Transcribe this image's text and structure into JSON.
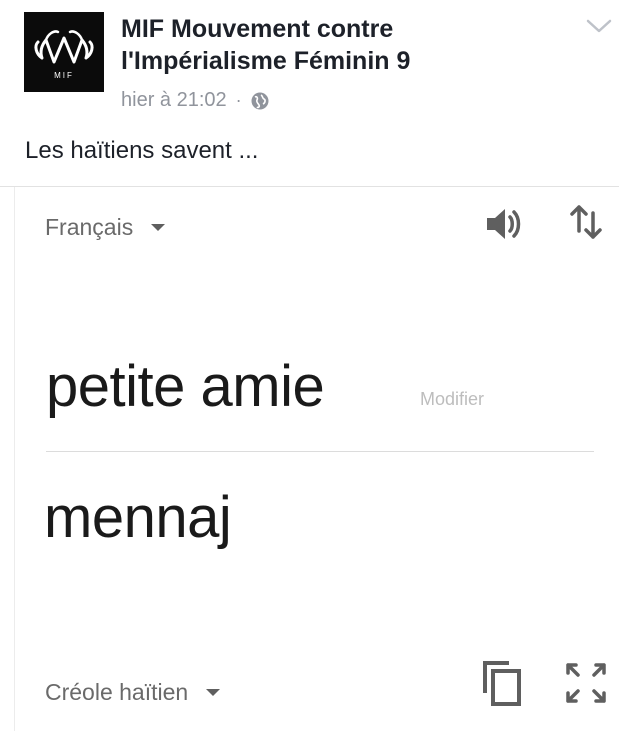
{
  "post": {
    "page_name": "MIF Mouvement contre l'Impérialisme Féminin 9",
    "avatar_letters": "MIF",
    "timestamp": "hier à 21:02",
    "separator": "·",
    "privacy_icon": "globe-icon",
    "menu_icon": "chevron-down-icon",
    "text": "Les haïtiens savent ..."
  },
  "translator": {
    "source_language": "Français",
    "target_language": "Créole haïtien",
    "source_text": "petite amie",
    "edit_label": "Modifier",
    "translated_text": "mennaj",
    "icons": {
      "speak": "speaker-icon",
      "swap": "swap-languages-icon",
      "copy": "copy-icon",
      "fullscreen": "fullscreen-icon"
    }
  },
  "colors": {
    "primary_text": "#1d2129",
    "meta_text": "#90949c",
    "avatar_bg": "#0b0b0b",
    "icon_gray": "#5f5f5f"
  }
}
